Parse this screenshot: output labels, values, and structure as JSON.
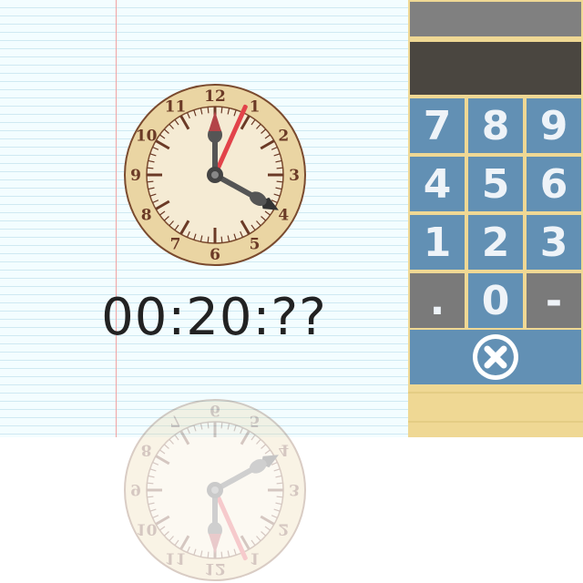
{
  "time_readout": "00:20:??",
  "clock": {
    "numerals": [
      "12",
      "1",
      "2",
      "3",
      "4",
      "5",
      "6",
      "7",
      "8",
      "9",
      "10",
      "11"
    ],
    "hour_hand_angle_deg": 119,
    "minute_hand_angle_deg": 24,
    "face_color": "#f5ebd4",
    "ring_color": "#ead5a3",
    "numeral_color": "#6b3a26",
    "minute_hand_color": "#e2434a",
    "hour_hand_color": "#555555"
  },
  "keypad": {
    "rows": [
      [
        "7",
        "8",
        "9"
      ],
      [
        "4",
        "5",
        "6"
      ],
      [
        "1",
        "2",
        "3"
      ],
      [
        ".",
        "0",
        "-"
      ]
    ],
    "clear_icon": "close-circle-icon",
    "key_color": "#6290b4",
    "gray_key_color": "#7a7a7a"
  },
  "display": {
    "value": ""
  }
}
